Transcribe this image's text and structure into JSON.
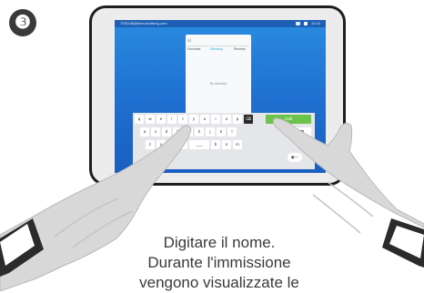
{
  "step_number": "❸",
  "status_bar": {
    "uri": "7031168@tbm.tandberg.com",
    "time": "10:10"
  },
  "search": {
    "icon": "search-icon",
    "value": ""
  },
  "tabs": [
    "Favorites",
    "Directory",
    "Recents"
  ],
  "active_tab": "Directory",
  "empty_message": "No directory",
  "keyboard": {
    "row1": [
      "q",
      "w",
      "e",
      "r",
      "t",
      "y",
      "u",
      "i",
      "o",
      "p"
    ],
    "row2": [
      "a",
      "s",
      "d",
      "f",
      "g",
      "h",
      "j",
      "k",
      "l"
    ],
    "row3": [
      "z",
      "x",
      "c",
      "v",
      "b",
      "n",
      "m"
    ],
    "call_label": "Call"
  },
  "caption_lines": [
    "Digitare il nome.",
    "Durante l'immissione",
    "vengono visualizzate le"
  ],
  "colors": {
    "screen": "#1e6ed0",
    "call": "#6cc24a",
    "accent_tab": "#27a9e1"
  }
}
